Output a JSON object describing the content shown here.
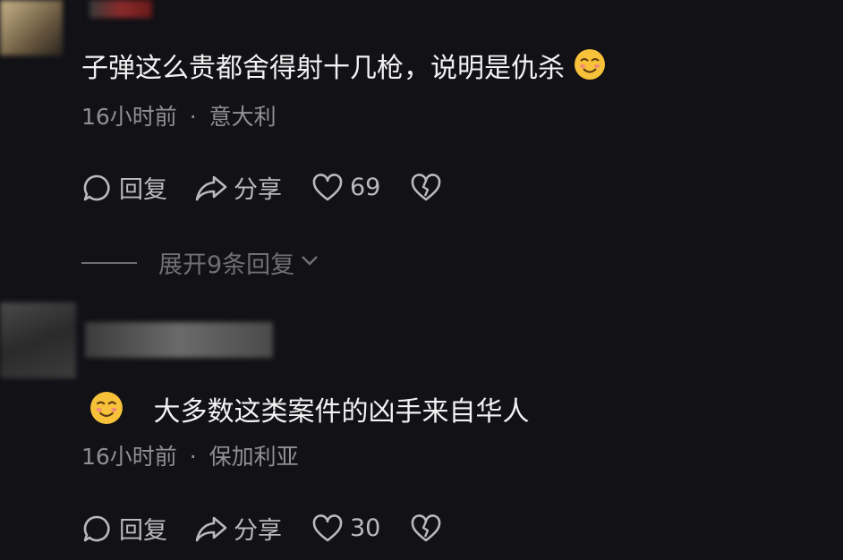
{
  "colors": {
    "background": "#111116",
    "text": "#f2f2f2",
    "meta": "#8f8f94",
    "action": "#b9b9be",
    "expand": "#6f6f74"
  },
  "comments": [
    {
      "text": "子弹这么贵都舍得射十几枪，说明是仇杀",
      "emoji": "smiling-emoji",
      "time": "16小时前",
      "separator": "·",
      "location": "意大利",
      "reply_label": "回复",
      "share_label": "分享",
      "likes": "69",
      "expand_label": "展开9条回复"
    },
    {
      "text": "大多数这类案件的凶手来自华人",
      "emoji": "smiling-emoji",
      "time": "16小时前",
      "separator": "·",
      "location": "保加利亚",
      "reply_label": "回复",
      "share_label": "分享",
      "likes": "30"
    }
  ]
}
